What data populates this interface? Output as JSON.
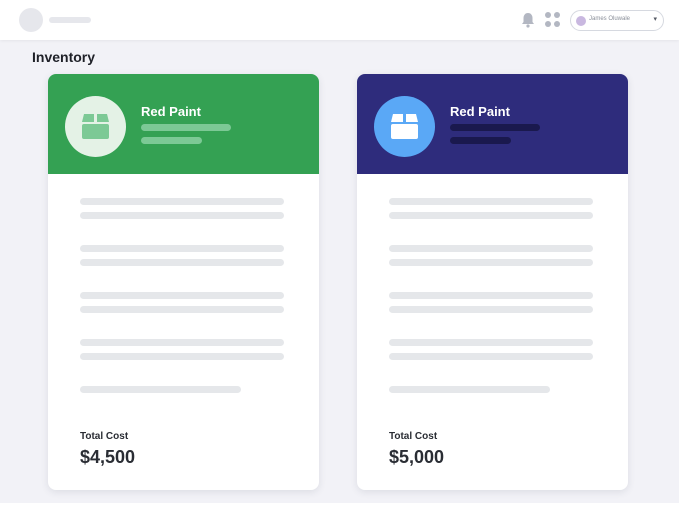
{
  "header": {
    "user_name": "James Oluwale",
    "icons": [
      "bell-icon",
      "apps-grid-icon",
      "chevron-down-icon"
    ]
  },
  "page": {
    "title": "Inventory"
  },
  "cards": [
    {
      "name": "Red Paint",
      "total_label": "Total Cost",
      "total_value": "$4,500",
      "header_color": "#34a153",
      "icon_bg": "#e4f2e6",
      "icon_color": "#7cc995",
      "line_color": "#7cc995",
      "icon": "box-icon"
    },
    {
      "name": "Red Paint",
      "total_label": "Total Cost",
      "total_value": "$5,000",
      "header_color": "#2e2c7c",
      "icon_bg": "#5aa8f6",
      "icon_color": "#ffffff",
      "line_color": "#1a194e",
      "icon": "box-icon"
    }
  ]
}
